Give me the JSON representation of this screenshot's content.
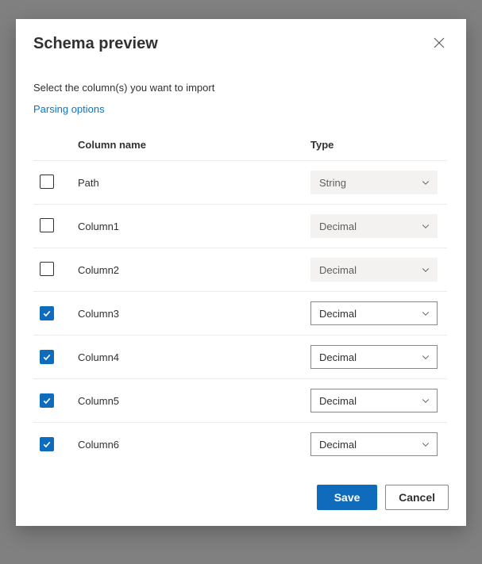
{
  "dialog": {
    "title": "Schema preview",
    "subtitle": "Select the column(s) you want to import",
    "parsing_link": "Parsing options",
    "headers": {
      "column_name": "Column name",
      "type": "Type"
    },
    "rows": [
      {
        "checked": false,
        "name": "Path",
        "type": "String",
        "enabled": false
      },
      {
        "checked": false,
        "name": "Column1",
        "type": "Decimal",
        "enabled": false
      },
      {
        "checked": false,
        "name": "Column2",
        "type": "Decimal",
        "enabled": false
      },
      {
        "checked": true,
        "name": "Column3",
        "type": "Decimal",
        "enabled": true
      },
      {
        "checked": true,
        "name": "Column4",
        "type": "Decimal",
        "enabled": true
      },
      {
        "checked": true,
        "name": "Column5",
        "type": "Decimal",
        "enabled": true
      },
      {
        "checked": true,
        "name": "Column6",
        "type": "Decimal",
        "enabled": true
      }
    ],
    "buttons": {
      "save": "Save",
      "cancel": "Cancel"
    }
  }
}
